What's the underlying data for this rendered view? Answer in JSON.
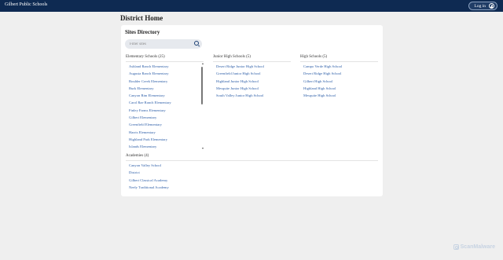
{
  "topbar": {
    "brand": "Gilbert Public Schools",
    "login_label": "Log in"
  },
  "page_title": "District Home",
  "directory": {
    "title": "Sites Directory",
    "search_placeholder": "Filter sites",
    "groups": [
      {
        "heading": "Elementary Schools (25)",
        "items": [
          "Ashland Ranch Elementary",
          "Augusta Ranch Elementary",
          "Boulder Creek Elementary",
          "Burk Elementary",
          "Canyon Rim Elementary",
          "Carol Rae Ranch Elementary",
          "Finley Farms Elementary",
          "Gilbert Elementary",
          "Greenfield Elementary",
          "Harris Elementary",
          "Highland Park Elementary",
          "Islands Elementary"
        ]
      },
      {
        "heading": "Junior High Schools (5)",
        "items": [
          "Desert Ridge Junior High School",
          "Greenfield Junior High School",
          "Highland Junior High School",
          "Mesquite Junior High School",
          "South Valley Junior High School"
        ]
      },
      {
        "heading": "High Schools (5)",
        "items": [
          "Campo Verde High School",
          "Desert Ridge High School",
          "Gilbert High School",
          "Highland High School",
          "Mesquite High School"
        ]
      },
      {
        "heading": "Academies (4)",
        "items": [
          "Canyon Valley School",
          "District",
          "Gilbert Classical Academy",
          "Neely Traditional Academy"
        ]
      }
    ]
  },
  "watermark": "ScanMalware"
}
